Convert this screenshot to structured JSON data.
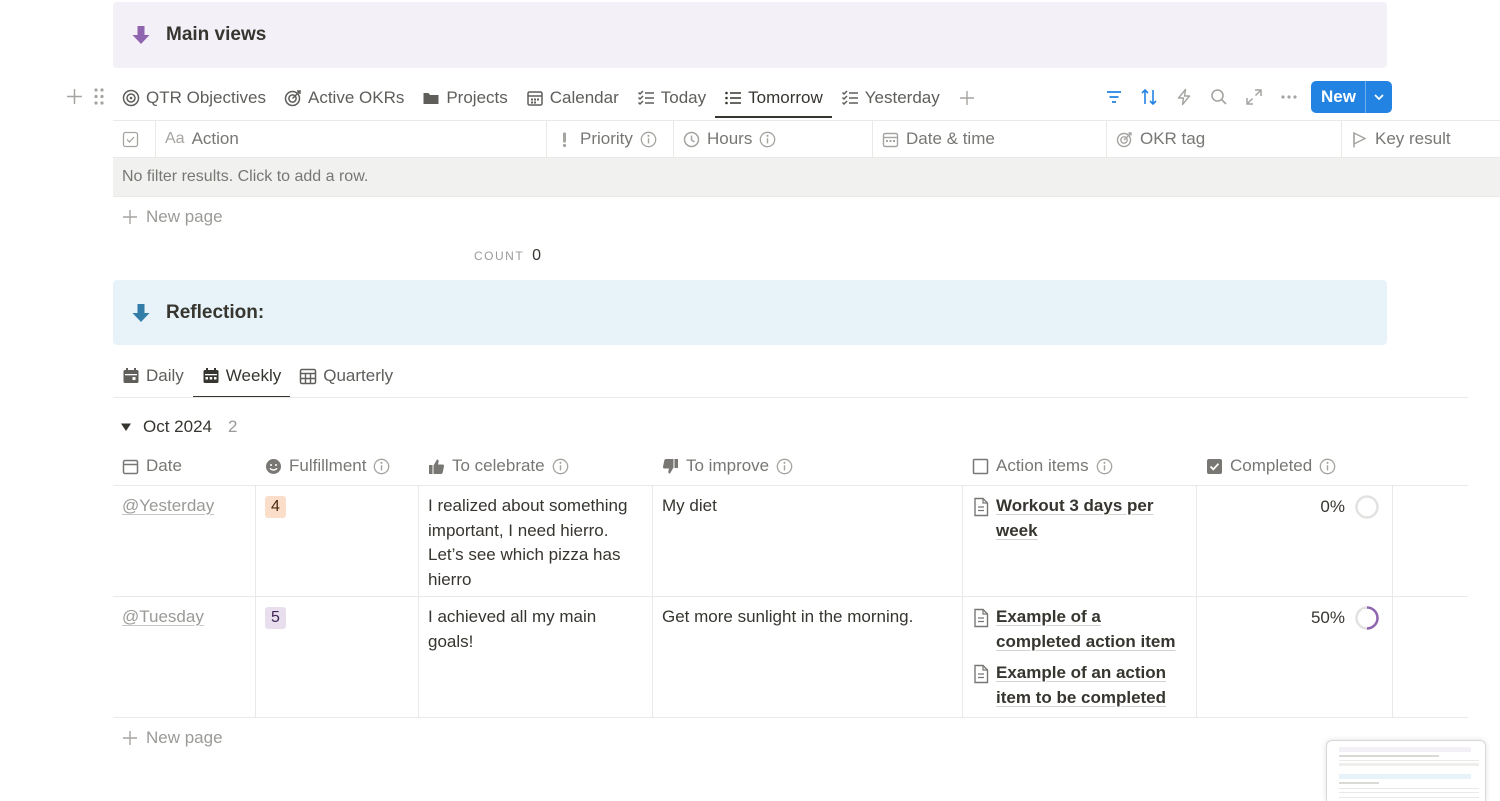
{
  "callouts": {
    "main_views": "Main views",
    "reflection": "Reflection:"
  },
  "views": [
    {
      "label": "QTR Objectives",
      "icon": "target-icon"
    },
    {
      "label": "Active OKRs",
      "icon": "target-arrow-icon"
    },
    {
      "label": "Projects",
      "icon": "folder-icon"
    },
    {
      "label": "Calendar",
      "icon": "calendar-icon"
    },
    {
      "label": "Today",
      "icon": "checklist-icon"
    },
    {
      "label": "Tomorrow",
      "icon": "list-icon",
      "active": true
    },
    {
      "label": "Yesterday",
      "icon": "checklist-icon"
    }
  ],
  "toolbar": {
    "new_label": "New"
  },
  "actions_table": {
    "columns": [
      "Action",
      "Priority",
      "Hours",
      "Date & time",
      "OKR tag",
      "Key result"
    ],
    "action_prefix": "Aa",
    "empty_text": "No filter results. Click to add a row.",
    "new_page": "New page",
    "count_label": "COUNT",
    "count_value": "0"
  },
  "reflection_tabs": [
    {
      "label": "Daily",
      "icon": "calendar-day-icon"
    },
    {
      "label": "Weekly",
      "icon": "calendar-week-icon",
      "active": true
    },
    {
      "label": "Quarterly",
      "icon": "calendar-grid-icon"
    }
  ],
  "group": {
    "name": "Oct 2024",
    "count": "2"
  },
  "reflection_table": {
    "columns": [
      "Date",
      "Fulfillment",
      "To celebrate",
      "To improve",
      "Action items",
      "Completed"
    ],
    "rows": [
      {
        "date": "@Yesterday",
        "fulfillment": "4",
        "celebrate": "I realized about something important, I need hierro. Let’s see which pizza has hierro",
        "improve": "My diet",
        "action_items": [
          "Workout 3 days per week"
        ],
        "completed": "0%"
      },
      {
        "date": "@Tuesday",
        "fulfillment": "5",
        "celebrate": "I achieved all my main goals!",
        "improve": "Get more sunlight in the morning.",
        "action_items": [
          "Example of a completed action item",
          "Example of an action item to be completed"
        ],
        "completed": "50%"
      }
    ],
    "new_page": "New page"
  },
  "colors": {
    "callout_purple": "#f4f0f7",
    "callout_blue": "#e7f3f8",
    "arrow_purple": "#9065b0",
    "arrow_blue": "#337ea9",
    "accent": "#2383e2",
    "badge_orange": "#fadec9",
    "badge_purple": "#e8deee",
    "progress": "#9065b0"
  }
}
